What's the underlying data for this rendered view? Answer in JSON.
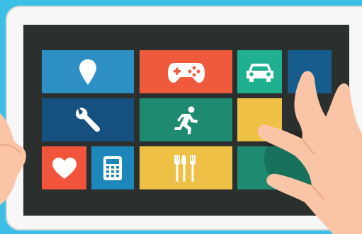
{
  "tiles": [
    {
      "id": "location",
      "icon": "map-pin-icon",
      "color": "#2d8fc4"
    },
    {
      "id": "games",
      "icon": "game-controller-icon",
      "color": "#ef5a3c"
    },
    {
      "id": "car",
      "icon": "car-icon",
      "color": "#1fb08f"
    },
    {
      "id": "blank-blue",
      "icon": "",
      "color": "#165c8c"
    },
    {
      "id": "settings",
      "icon": "wrench-icon",
      "color": "#15507e"
    },
    {
      "id": "fitness",
      "icon": "running-person-icon",
      "color": "#1e8a6f"
    },
    {
      "id": "yellow-small",
      "icon": "",
      "color": "#efc046"
    },
    {
      "id": "health",
      "icon": "heart-icon",
      "color": "#f0553c"
    },
    {
      "id": "calculator",
      "icon": "calculator-icon",
      "color": "#1d86ba"
    },
    {
      "id": "food",
      "icon": "fork-icon",
      "color": "#efc046"
    },
    {
      "id": "green-wide",
      "icon": "",
      "color": "#1e8a6f"
    }
  ],
  "colors": {
    "background": "#3cbfe6",
    "tablet": "#f7f7f7",
    "screen": "#2b2f2e",
    "skin": "#f9c5a6",
    "skin_shadow": "#e9a888"
  }
}
